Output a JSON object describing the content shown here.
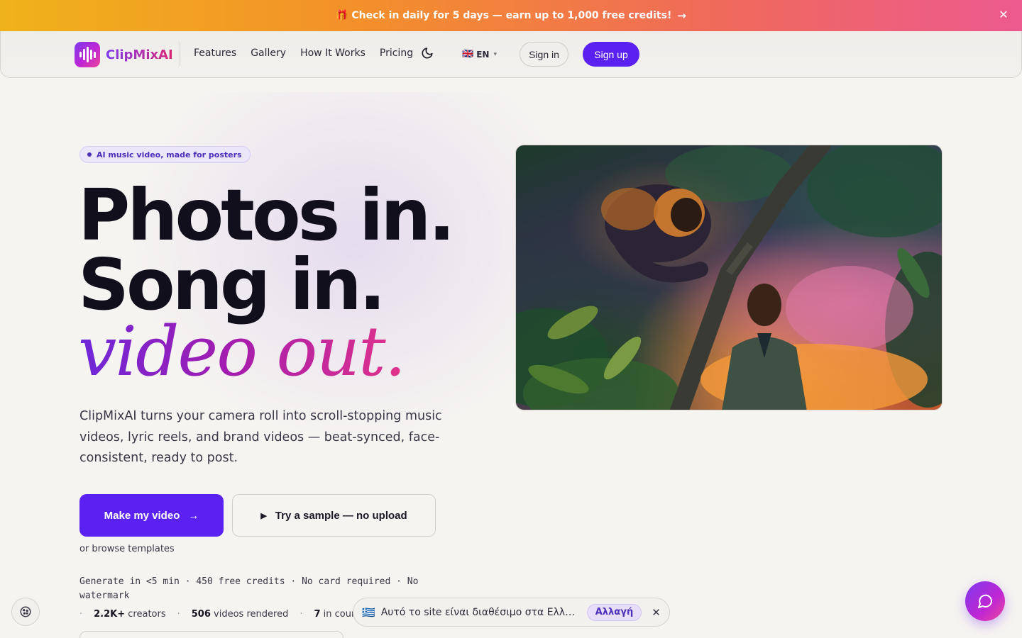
{
  "announcement": {
    "text": "🎁 Check in daily for 5 days — earn up to 1,000 free credits!",
    "arrow": "→",
    "close": "✕"
  },
  "nav": {
    "brand": "ClipMixAI",
    "links": [
      "Features",
      "Gallery",
      "How It Works",
      "Pricing"
    ],
    "theme_icon": "moon-icon",
    "language": {
      "flag": "🇬🇧",
      "code": "EN"
    },
    "signin_label": "Sign in",
    "signup_label": "Sign up"
  },
  "hero": {
    "badge": "AI music video, made for posters",
    "headline_1": "Photos in.",
    "headline_2": "Song in.",
    "headline_3": "video out.",
    "lede": "ClipMixAI turns your camera roll into scroll-stopping music videos, lyric reels, and brand videos — beat-synced, face-consistent, ready to post.",
    "cta_primary": "Make my video",
    "cta_secondary": "Try a sample — no upload",
    "browse": "or browse templates",
    "facts": "Generate in <5 min · 450 free credits · No card required · No watermark",
    "stats": [
      {
        "value": "2.2K+",
        "label": "creators"
      },
      {
        "value": "506",
        "label": "videos rendered"
      },
      {
        "value": "7",
        "label": "in coun"
      }
    ]
  },
  "language_toast": {
    "flag": "🇬🇷",
    "message": "Αυτό το site είναι διαθέσιμο στα Ελληνικά",
    "switch_label": "Αλλαγή",
    "close": "✕"
  },
  "colors": {
    "accent": "#5b21f0",
    "gradient_start": "#7c3aed",
    "gradient_end": "#ec4899",
    "background": "#f6f4f1"
  }
}
